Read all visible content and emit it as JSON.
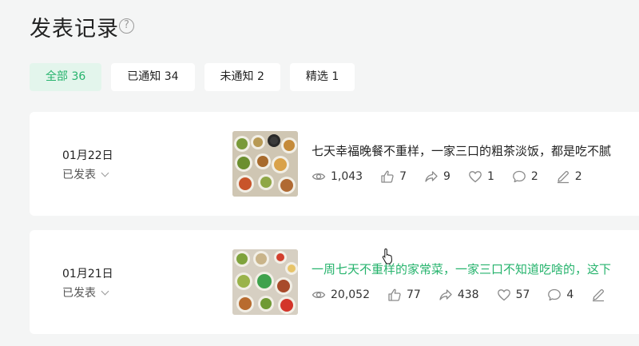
{
  "page": {
    "title": "发表记录",
    "help_icon": "question-circle-icon"
  },
  "tabs": [
    {
      "label": "全部 36",
      "active": true
    },
    {
      "label": "已通知 34",
      "active": false
    },
    {
      "label": "未通知 2",
      "active": false
    },
    {
      "label": "精选 1",
      "active": false
    }
  ],
  "articles": [
    {
      "date": "01月22日",
      "status": "已发表",
      "title": "七天幸福晚餐不重样，一家三口的粗茶淡饭，都是吃不腻",
      "stats": {
        "views": "1,043",
        "likes": "7",
        "shares": "9",
        "favorites": "1",
        "comments": "2",
        "edits": "2"
      }
    },
    {
      "date": "01月21日",
      "status": "已发表",
      "title": "一周七天不重样的家常菜，一家三口不知道吃啥的，这下",
      "stats": {
        "views": "20,052",
        "likes": "77",
        "shares": "438",
        "favorites": "57",
        "comments": "4",
        "edits": ""
      }
    }
  ],
  "colors": {
    "accent": "#25b36c",
    "active_tab_bg": "#e3f5ec",
    "background": "#f4f5f5"
  }
}
